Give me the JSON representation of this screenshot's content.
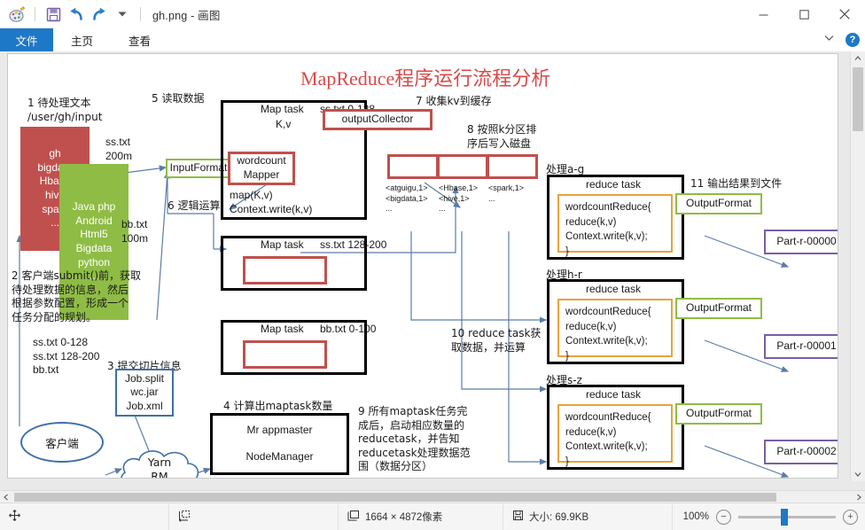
{
  "window": {
    "title": "gh.png - 画图",
    "quick_access": [
      "paint-palette-icon",
      "save-icon",
      "undo-icon",
      "redo-icon",
      "customize-chevron-icon"
    ],
    "minimize_label": "最小化",
    "maximize_label": "最大化",
    "close_label": "关闭",
    "ribbon_collapse_label": "功能区选项",
    "help_label": "?"
  },
  "ribbon": {
    "tabs": [
      {
        "label": "文件",
        "active": true
      },
      {
        "label": "主页",
        "active": false
      },
      {
        "label": "查看",
        "active": false
      }
    ]
  },
  "status": {
    "cursor_icon": "cursor-position-icon",
    "selection_icon": "selection-size-icon",
    "dimensions_icon": "image-size-icon",
    "dimensions": "1664 × 4872像素",
    "filesize_icon": "file-size-icon",
    "filesize": "大小: 69.9KB",
    "zoom_level": "100%",
    "zoom_out": "−",
    "zoom_in": "+"
  },
  "diagram": {
    "title": "MapReduce程序运行流程分析",
    "title_color": "#d94a4a",
    "steps": {
      "s1": "1 待处理文本\n/user/gh/input",
      "s2": "2 客户端submit()前，获取\n待处理数据的信息，然后\n根据参数配置，形成一个\n任务分配的规划。",
      "s3": "3 提交切片信息",
      "s4": "4 计算出maptask数量",
      "s5": "5 读取数据",
      "s6": "6 逻辑运算",
      "s7": "7 收集kv到缓存",
      "s8": "8 按照k分区排\n序后写入磁盘",
      "s9": "9 所有maptask任务完\n成后，启动相应数量的\nreducetask，并告知\nreducetask处理数据范\n围（数据分区）",
      "s10": "10 reduce task获\n取数据，并运算",
      "s11": "11 输出结果到文件"
    },
    "input_red_box": "gh\nbigdata\nHbase\nhive\nspark\n...",
    "input_green_box": "Java php\nAndroid\nHtml5\nBigdata\npython\n...",
    "file_labels": {
      "ss": "ss.txt\n200m",
      "bb": "bb.txt\n100m"
    },
    "split_plan": "ss.txt 0-128\nss.txt 128-200\nbb.txt",
    "job_box": "Job.split\nwc.jar\nJob.xml",
    "client": "客户端",
    "yarn": "Yarn\nRM",
    "appmaster": "Mr appmaster",
    "nodemanager": "NodeManager",
    "input_format": "InputFormat",
    "maptasks": [
      {
        "name": "Map task",
        "range": "ss.txt 0-128"
      },
      {
        "name": "Map task",
        "range": "ss.txt 128-200"
      },
      {
        "name": "Map task",
        "range": "bb.txt 0-100"
      }
    ],
    "maptask1": {
      "kv": "K,v",
      "output_collector": "outputCollector",
      "mapper": "wordcount\nMapper",
      "code": "map(K,v)\nContext.write(k,v)"
    },
    "partitions": [
      "<atguigu,1>\n<bigdata,1>\n...",
      "<Hbase,1>\n<hive,1>\n...",
      "<spark,1>\n...\n"
    ],
    "reduce_tasks": [
      {
        "range_label": "处理a-g",
        "title": "reduce task",
        "code": "wordcountReduce{\nreduce(k,v)\nContext.write(k,v);\n}",
        "output_format": "OutputFormat",
        "part": "Part-r-00000"
      },
      {
        "range_label": "处理h-r",
        "title": "reduce task",
        "code": "wordcountReduce{\nreduce(k,v)\nContext.write(k,v);\n}",
        "output_format": "OutputFormat",
        "part": "Part-r-00001"
      },
      {
        "range_label": "处理s-z",
        "title": "reduce task",
        "code": "wordcountReduce{\nreduce(k,v)\nContext.write(k,v);\n}",
        "output_format": "OutputFormat",
        "part": "Part-r-00002"
      }
    ]
  }
}
